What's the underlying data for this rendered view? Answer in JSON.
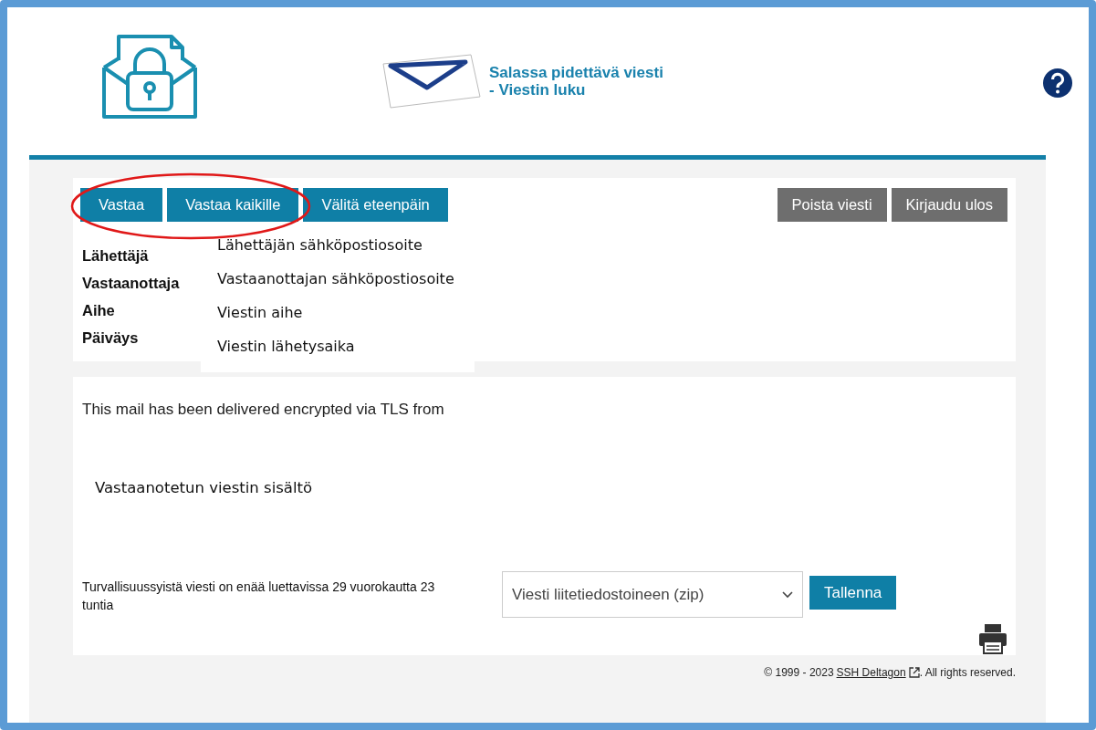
{
  "header": {
    "title_lines": [
      "Salassa pidettävä viesti",
      "- Viestin luku"
    ]
  },
  "toolbar": {
    "left_buttons": [
      "Vastaa",
      "Vastaa kaikille",
      "Välitä eteenpäin"
    ],
    "right_buttons": [
      "Poista viesti",
      "Kirjaudu ulos"
    ]
  },
  "annotation": {
    "kind": "ellipse"
  },
  "fields": [
    {
      "label": "Lähettäjä",
      "value": "Lähettäjän sähköpostiosoite"
    },
    {
      "label": "Vastaanottaja",
      "value": "Vastaanottajan sähköpostiosoite"
    },
    {
      "label": "Aihe",
      "value": "Viestin aihe"
    },
    {
      "label": "Päiväys",
      "value": "Viestin lähetysaika"
    }
  ],
  "message": {
    "notice": "This mail has been delivered encrypted via TLS from",
    "content": "Vastaanotetun viestin sisältö"
  },
  "save": {
    "retention": "Turvallisuussyistä viesti on enää luettavissa 29 vuorokautta 23 tuntia",
    "format": "Viesti liitetiedostoineen (zip)",
    "button": "Tallenna"
  },
  "footer": {
    "copyright": "© 1999 - 2023",
    "link": "SSH Deltagon",
    "rights": ". All rights reserved."
  }
}
